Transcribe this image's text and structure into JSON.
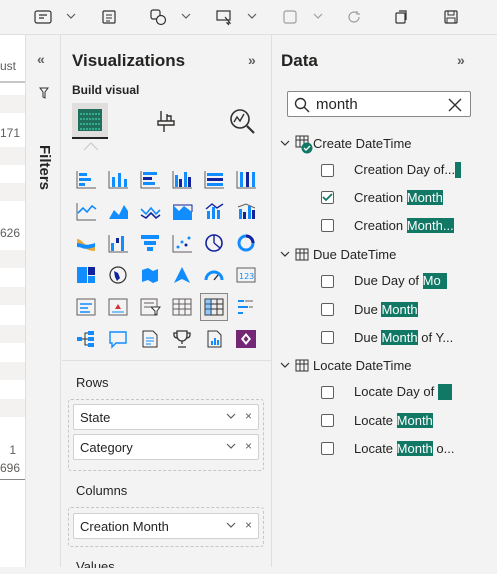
{
  "toolbar": {
    "icons": [
      "format-icon",
      "text-box-icon",
      "shapes-icon",
      "visual-interactions-icon",
      "duplicate-icon",
      "refresh-icon",
      "copy-icon",
      "save-icon"
    ]
  },
  "report_edge": {
    "header_text": "ust",
    "numbers": [
      "171",
      "626",
      "1",
      "696"
    ]
  },
  "filters": {
    "label": "Filters"
  },
  "visualizations": {
    "title": "Visualizations",
    "build_visual": "Build visual",
    "wells": {
      "rows_label": "Rows",
      "rows": [
        "State",
        "Category"
      ],
      "columns_label": "Columns",
      "columns": [
        "Creation Month"
      ],
      "values_label": "Values"
    }
  },
  "data_pane": {
    "title": "Data",
    "search_value": "month",
    "tables": [
      {
        "name": "Create DateTime",
        "fields": [
          {
            "pre": "Creation Day of...",
            "hl": "",
            "post": "",
            "checked": false
          },
          {
            "pre": "Creation ",
            "hl": "Month",
            "post": "",
            "checked": true
          },
          {
            "pre": "Creation ",
            "hl": "Month...",
            "post": "",
            "checked": false
          }
        ]
      },
      {
        "name": "Due DateTime",
        "fields": [
          {
            "pre": "Due Day of ",
            "hl": "Mo",
            "post": "",
            "checked": false
          },
          {
            "pre": "Due ",
            "hl": "Month",
            "post": "",
            "checked": false
          },
          {
            "pre": "Due ",
            "hl": "Month",
            "post": " of Y...",
            "checked": false
          }
        ]
      },
      {
        "name": "Locate DateTime",
        "fields": [
          {
            "pre": "Locate Day of ",
            "hl": "",
            "post": "",
            "checked": false
          },
          {
            "pre": "Locate ",
            "hl": "Month",
            "post": "",
            "checked": false
          },
          {
            "pre": "Locate ",
            "hl": "Month",
            "post": " o...",
            "checked": false
          }
        ]
      }
    ]
  },
  "colors": {
    "accent": "#117865",
    "chart_blue": "#118dff",
    "chart_dark": "#12239e"
  }
}
